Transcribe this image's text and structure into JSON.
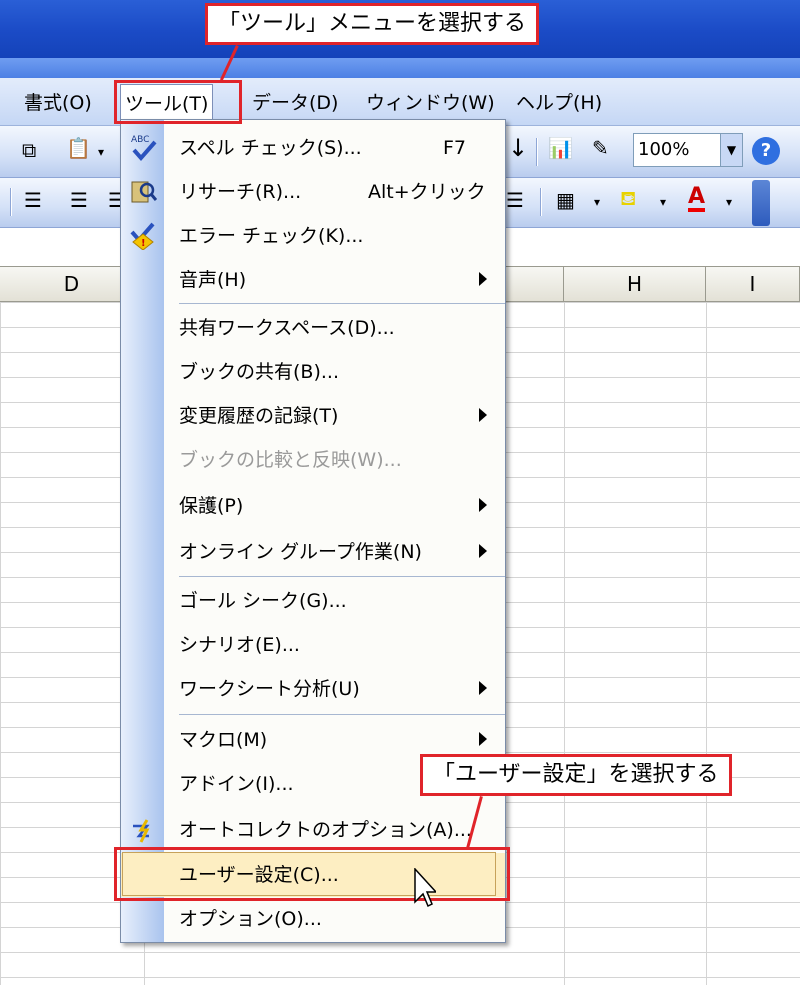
{
  "menubar": {
    "items": [
      {
        "label": "書式(O)"
      },
      {
        "label": "ツール(T)"
      },
      {
        "label": "データ(D)"
      },
      {
        "label": "ウィンドウ(W)"
      },
      {
        "label": "ヘルプ(H)"
      }
    ]
  },
  "toolbar": {
    "zoom_value": "100%",
    "help_label": "?"
  },
  "sheet": {
    "columns": [
      "D",
      "H",
      "I"
    ]
  },
  "tools_menu": {
    "items": [
      {
        "label": "スペル チェック(S)...",
        "shortcut": "F7",
        "icon": "spellcheck-icon"
      },
      {
        "label": "リサーチ(R)...",
        "shortcut": "Alt+クリック",
        "icon": "research-icon"
      },
      {
        "label": "エラー チェック(K)...",
        "icon": "error-check-icon"
      },
      {
        "label": "音声(H)",
        "submenu": true
      },
      {
        "label": "共有ワークスペース(D)..."
      },
      {
        "label": "ブックの共有(B)..."
      },
      {
        "label": "変更履歴の記録(T)",
        "submenu": true
      },
      {
        "label": "ブックの比較と反映(W)...",
        "disabled": true
      },
      {
        "label": "保護(P)",
        "submenu": true
      },
      {
        "label": "オンライン グループ作業(N)",
        "submenu": true
      },
      {
        "label": "ゴール シーク(G)..."
      },
      {
        "label": "シナリオ(E)..."
      },
      {
        "label": "ワークシート分析(U)",
        "submenu": true
      },
      {
        "label": "マクロ(M)",
        "submenu": true
      },
      {
        "label": "アドイン(I)..."
      },
      {
        "label": "オートコレクトのオプション(A)...",
        "icon": "autocorrect-icon"
      },
      {
        "label": "ユーザー設定(C)...",
        "highlighted": true
      },
      {
        "label": "オプション(O)..."
      }
    ]
  },
  "annotations": {
    "top": "「ツール」メニューを選択する",
    "bottom": "「ユーザー設定」を選択する"
  },
  "colors": {
    "callout_red": "#e0242a",
    "highlight": "#fdeec2",
    "title_blue": "#1b4bc6"
  }
}
